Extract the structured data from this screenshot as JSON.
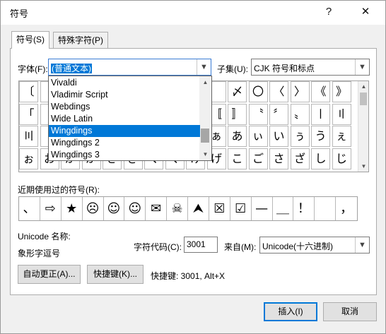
{
  "window": {
    "title": "符号",
    "help": "?",
    "close": "✕"
  },
  "tabs": [
    {
      "label": "符号(S)"
    },
    {
      "label": "特殊字符(P)"
    }
  ],
  "font": {
    "label": "字体(F):",
    "value": "(普通文本)"
  },
  "subset": {
    "label": "子集(U):",
    "value": "CJK 符号和标点"
  },
  "font_dropdown": {
    "items": [
      "Vivaldi",
      "Vladimir Script",
      "Webdings",
      "Wide Latin",
      "Wingdings",
      "Wingdings 2",
      "Wingdings 3"
    ],
    "selected_index": 4
  },
  "grid": {
    "rows": [
      [
        "〔",
        "",
        "",
        "",
        "",
        "",
        "",
        "",
        "",
        "",
        "〆",
        "〇",
        "〈",
        "〉",
        "《",
        "》"
      ],
      [
        "「",
        "",
        "",
        "",
        "",
        "",
        "",
        "",
        "",
        "〚",
        "〛",
        "〝",
        "〞",
        "〟",
        "〡",
        "〢"
      ],
      [
        "〣",
        "",
        "",
        "",
        "",
        "",
        "",
        "",
        "",
        "ぁ",
        "あ",
        "ぃ",
        "い",
        "ぅ",
        "う",
        "ぇ",
        "え"
      ],
      [
        "ぉ",
        "お",
        "か",
        "が",
        "き",
        "ぎ",
        "く",
        "ぐ",
        "け",
        "げ",
        "こ",
        "ご",
        "さ",
        "ざ",
        "し",
        "じ"
      ]
    ]
  },
  "recent": {
    "label": "近期使用过的符号(R):",
    "symbols": [
      "、",
      "⇨",
      "★",
      "☹",
      "☺",
      "☺",
      "✉",
      "☠",
      "⮝",
      "☒",
      "☑",
      "—",
      "＿",
      "！",
      "",
      "，"
    ]
  },
  "unicode_name": {
    "label": "Unicode 名称:",
    "value": "象形字逗号"
  },
  "char_code": {
    "label": "字符代码(C):",
    "value": "3001"
  },
  "from": {
    "label": "来自(M):",
    "value": "Unicode(十六进制)"
  },
  "buttons": {
    "autocorrect": "自动更正(A)...",
    "shortcut": "快捷键(K)...",
    "shortcut_info": "快捷键: 3001, Alt+X",
    "insert": "插入(I)",
    "cancel": "取消"
  }
}
